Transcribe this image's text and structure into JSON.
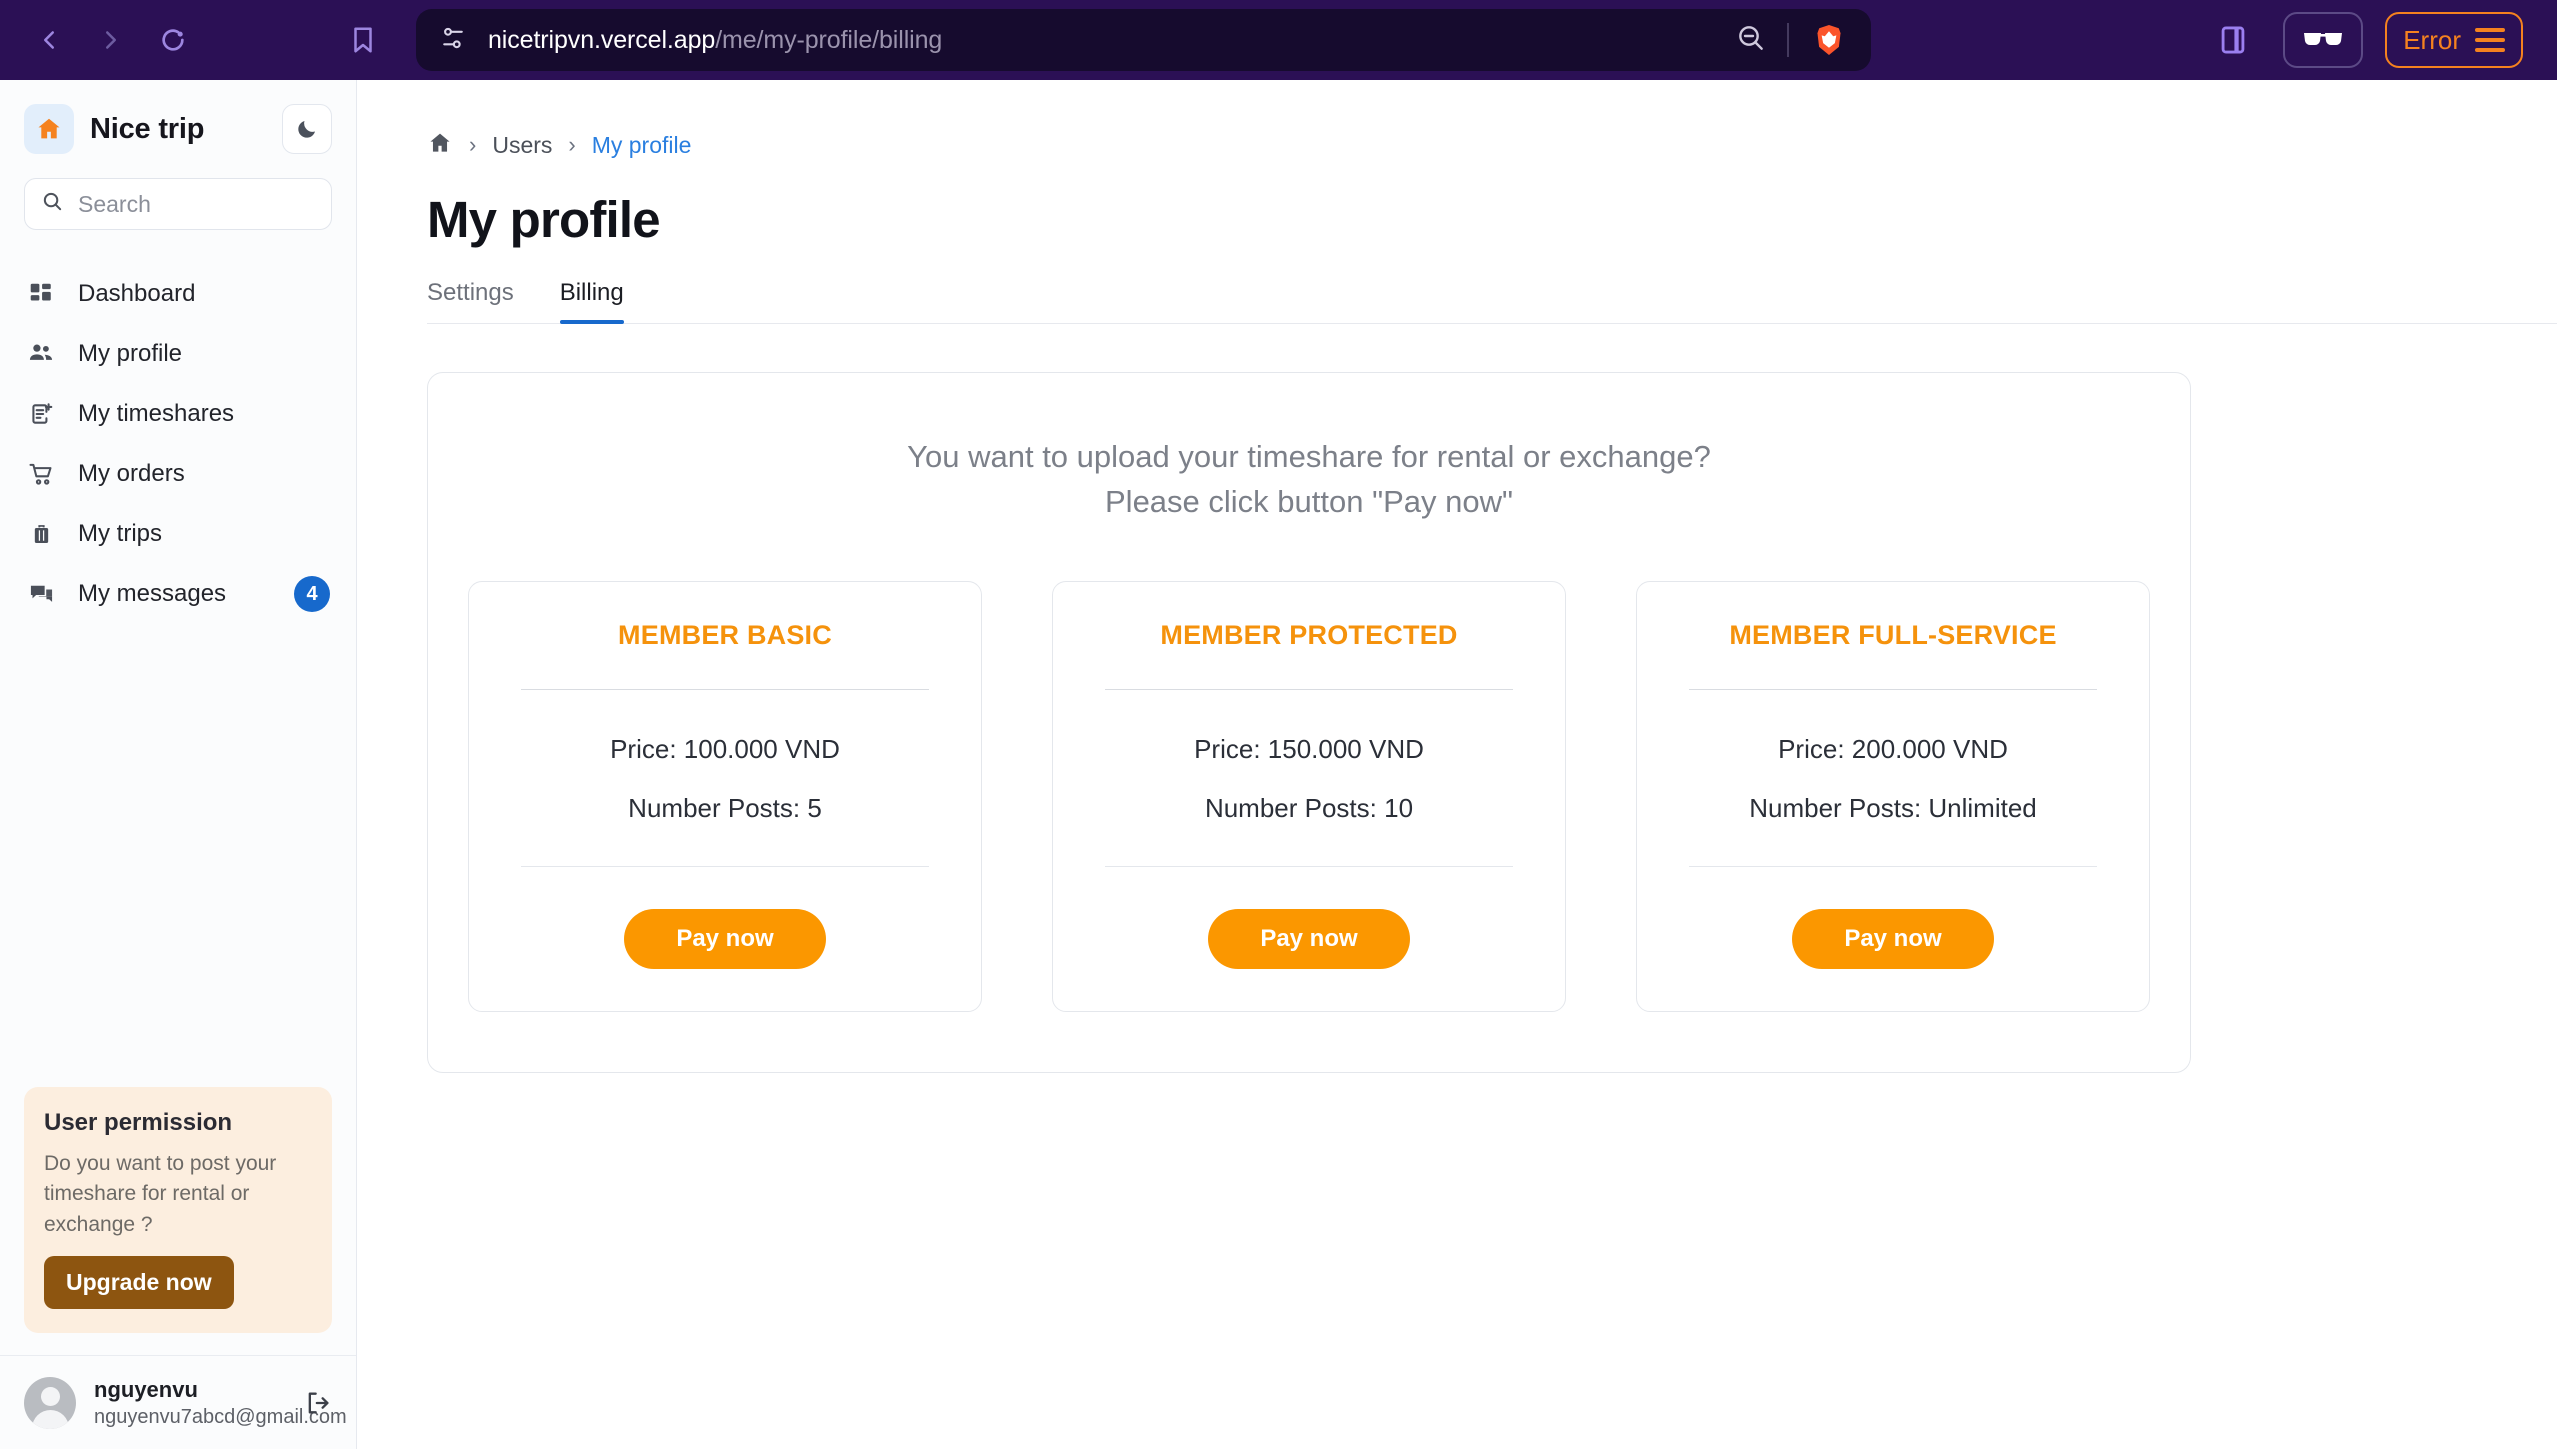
{
  "browser": {
    "back_label": "Back",
    "forward_label": "Forward",
    "reload_label": "Reload",
    "bookmark_label": "Bookmark",
    "url_domain": "nicetripvn.vercel.app",
    "url_path": "/me/my-profile/billing",
    "zoom_out_label": "Zoom out",
    "brave_label": "Brave Shields",
    "sidebar_toggle_label": "Toggle sidebar",
    "reader_label": "Reader mode",
    "error_label": "Error",
    "menu_label": "Menu",
    "chrome_bg": "#2b1055",
    "accent": "#f5821f"
  },
  "sidebar": {
    "brand": "Nice trip",
    "theme_toggle_label": "Dark mode",
    "search": {
      "placeholder": "Search"
    },
    "items": [
      {
        "label": "Dashboard",
        "icon": "dashboard-icon",
        "badge": ""
      },
      {
        "label": "My profile",
        "icon": "users-icon",
        "badge": ""
      },
      {
        "label": "My timeshares",
        "icon": "document-add-icon",
        "badge": ""
      },
      {
        "label": "My orders",
        "icon": "cart-icon",
        "badge": ""
      },
      {
        "label": "My trips",
        "icon": "suitcase-icon",
        "badge": ""
      },
      {
        "label": "My messages",
        "icon": "chat-icon",
        "badge": "4"
      }
    ],
    "permission": {
      "title": "User permission",
      "description": "Do you want to post your timeshare for rental or exchange ?",
      "button": "Upgrade now",
      "bg": "#fceedf",
      "button_bg": "#8d5510"
    },
    "user": {
      "name": "nguyenvu",
      "email": "nguyenvu7abcd@gmail.com",
      "logout_label": "Logout"
    }
  },
  "main": {
    "breadcrumb": {
      "home": "Home",
      "parent": "Users",
      "current": "My profile"
    },
    "title": "My profile",
    "tabs": [
      {
        "label": "Settings",
        "active": false
      },
      {
        "label": "Billing",
        "active": true
      }
    ],
    "panel": {
      "heading_line1": "You want to upload your timeshare for rental or exchange?",
      "heading_line2": "Please click button \"Pay now\"",
      "plans": [
        {
          "title": "MEMBER BASIC",
          "price": "Price: 100.000 VND",
          "posts": "Number Posts: 5",
          "button": "Pay now"
        },
        {
          "title": "MEMBER PROTECTED",
          "price": "Price: 150.000 VND",
          "posts": "Number Posts: 10",
          "button": "Pay now"
        },
        {
          "title": "MEMBER FULL-SERVICE",
          "price": "Price: 200.000 VND",
          "posts": "Number Posts: Unlimited",
          "button": "Pay now"
        }
      ],
      "plan_title_color": "#f5920c",
      "pay_button_color": "#fb9700"
    }
  }
}
